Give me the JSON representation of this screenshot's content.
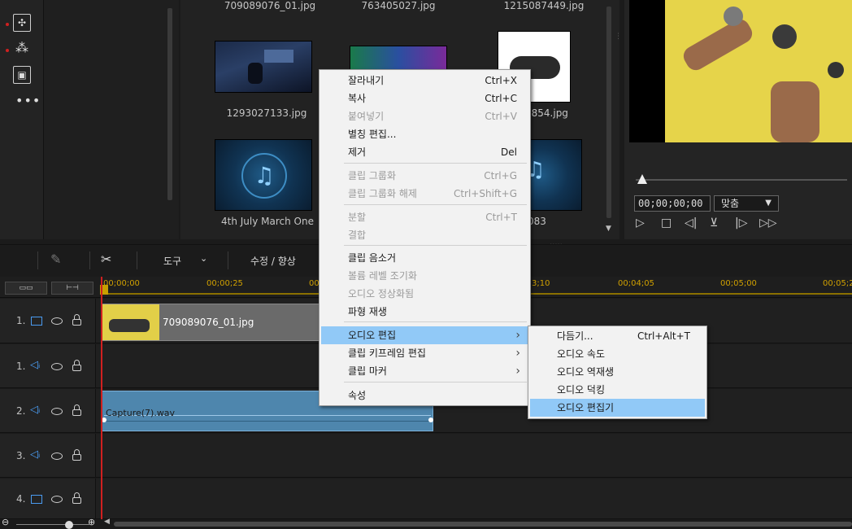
{
  "media": {
    "top_captions": [
      "709089076_01.jpg",
      "763405027.jpg",
      "1215087449.jpg"
    ],
    "row1": [
      "1293027133.jpg",
      "",
      "9854.jpg"
    ],
    "row2": [
      "4th July March One",
      "",
      "083"
    ]
  },
  "preview": {
    "timecode": "00;00;00;00",
    "fit_label": "맞춤"
  },
  "toolbar": {
    "tools_label": "도구",
    "edit_label": "수정 / 향상"
  },
  "ruler": {
    "ticks": [
      "00;00;00",
      "00;00;25",
      "00",
      "3;10",
      "00;04;05",
      "00;05;00",
      "00;05;2"
    ]
  },
  "tracks": [
    {
      "num": "1.",
      "kind": "video",
      "clip": "709089076_01.jpg"
    },
    {
      "num": "1.",
      "kind": "audio",
      "clip": ""
    },
    {
      "num": "2.",
      "kind": "audio",
      "clip": "Capture(7).wav"
    },
    {
      "num": "3.",
      "kind": "audio",
      "clip": ""
    },
    {
      "num": "4.",
      "kind": "video",
      "clip": ""
    }
  ],
  "context_menu": [
    {
      "label": "잘라내기",
      "shortcut": "Ctrl+X",
      "disabled": false
    },
    {
      "label": "복사",
      "shortcut": "Ctrl+C",
      "disabled": false
    },
    {
      "label": "붙여넣기",
      "shortcut": "Ctrl+V",
      "disabled": true
    },
    {
      "label": "별칭 편집...",
      "shortcut": "",
      "disabled": false
    },
    {
      "label": "제거",
      "shortcut": "Del",
      "disabled": false
    },
    {
      "label": "클립 그룹화",
      "shortcut": "Ctrl+G",
      "disabled": true
    },
    {
      "label": "클립 그룹화 해제",
      "shortcut": "Ctrl+Shift+G",
      "disabled": true
    },
    {
      "label": "분할",
      "shortcut": "Ctrl+T",
      "disabled": true
    },
    {
      "label": "결합",
      "shortcut": "",
      "disabled": true
    },
    {
      "label": "클립 음소거",
      "shortcut": "",
      "disabled": false
    },
    {
      "label": "볼륨 레벨 조기화",
      "shortcut": "",
      "disabled": true
    },
    {
      "label": "오디오 정상화됨",
      "shortcut": "",
      "disabled": true
    },
    {
      "label": "파형 재생",
      "shortcut": "",
      "disabled": false
    },
    {
      "label": "오디오 편집",
      "shortcut": "",
      "disabled": false
    },
    {
      "label": "클립 키프레임 편집",
      "shortcut": "",
      "disabled": false
    },
    {
      "label": "클립 마커",
      "shortcut": "",
      "disabled": false
    },
    {
      "label": "속성",
      "shortcut": "",
      "disabled": false
    }
  ],
  "submenu": [
    {
      "label": "다듬기...",
      "shortcut": "Ctrl+Alt+T"
    },
    {
      "label": "오디오 속도",
      "shortcut": ""
    },
    {
      "label": "오디오 역재생",
      "shortcut": ""
    },
    {
      "label": "오디오 덕킹",
      "shortcut": ""
    },
    {
      "label": "오디오 편집기",
      "shortcut": ""
    }
  ]
}
